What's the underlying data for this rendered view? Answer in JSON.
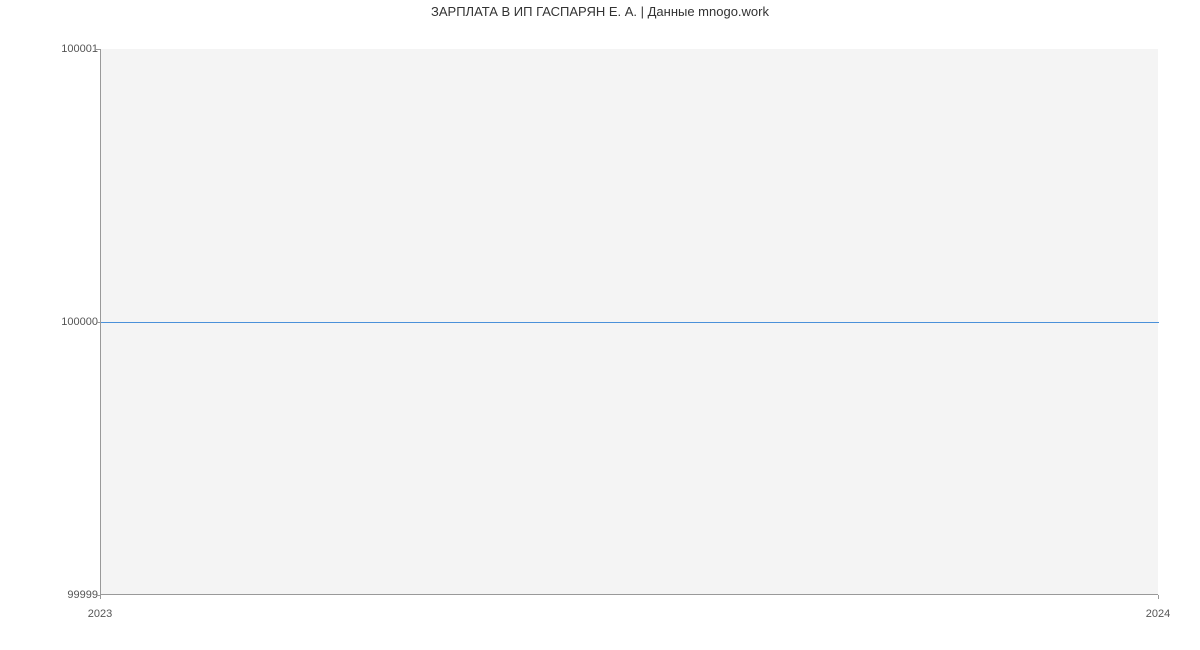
{
  "chart_data": {
    "type": "line",
    "title": "ЗАРПЛАТА В ИП ГАСПАРЯН Е. А. | Данные mnogo.work",
    "xlabel": "",
    "ylabel": "",
    "x_ticks": [
      "2023",
      "2024"
    ],
    "y_ticks": [
      "99999",
      "100000",
      "100001"
    ],
    "ylim": [
      99999,
      100001
    ],
    "series": [
      {
        "name": "salary",
        "x": [
          "2023",
          "2024"
        ],
        "values": [
          100000,
          100000
        ]
      }
    ],
    "colors": {
      "line": "#4a90d9",
      "plot_bg": "#f4f4f4"
    }
  }
}
